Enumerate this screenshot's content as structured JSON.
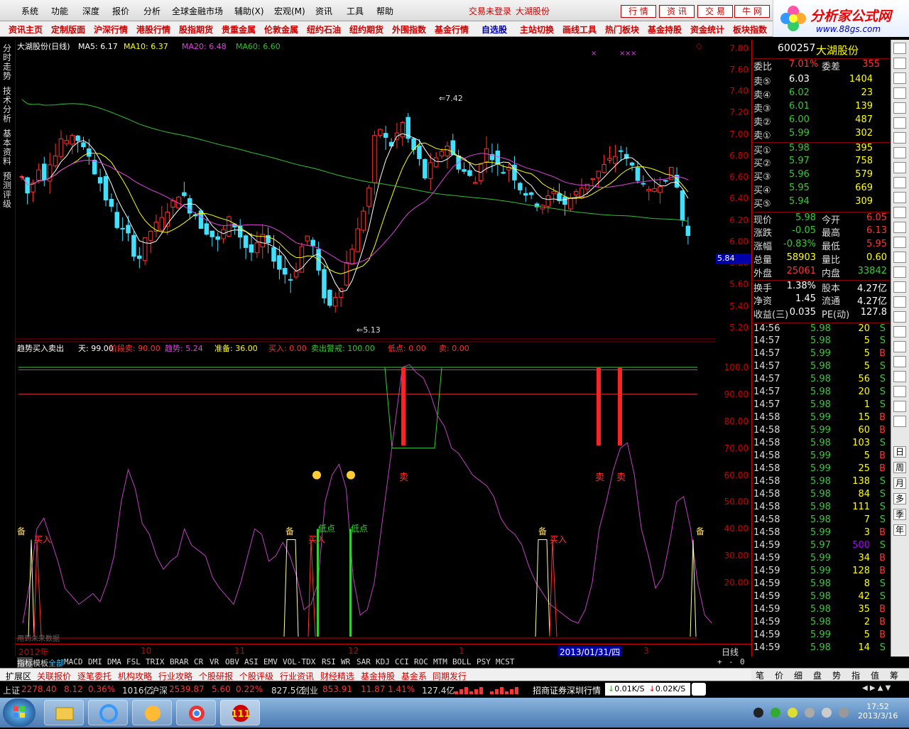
{
  "menu": {
    "items": [
      "系统",
      "功能",
      "深度",
      "报价",
      "分析",
      "全球金融市场",
      "辅助(X)",
      "宏观(M)",
      "资讯",
      "工具",
      "帮助"
    ],
    "login_status": "交易未登录",
    "stock_title": "大湖股份",
    "buttons": [
      "行 情",
      "资 讯",
      "交 易",
      "牛 网"
    ]
  },
  "logo": {
    "name": "分析家公式网",
    "url": "www.88gs.com"
  },
  "nav": {
    "items": [
      "资讯主页",
      "定制版面",
      "沪深行情",
      "港股行情",
      "股指期货",
      "贵重金属",
      "伦敦金属",
      "纽约石油",
      "纽约期货",
      "外围指数",
      "基金行情",
      "自选股",
      "主站切换",
      "画线工具",
      "热门板块",
      "基金持股",
      "资金统计",
      "板块指数"
    ]
  },
  "left_tabs": [
    "分时走势",
    "技术分析",
    "基本资料",
    "预测评级"
  ],
  "main_chart": {
    "header_name": "大湖股份(日线)",
    "ma5": "MA5: 6.17",
    "ma10": "MA10: 6.37",
    "ma20": "MA20: 6.48",
    "ma60": "MA60: 6.60",
    "high_label": "7.42",
    "low_label": "5.13",
    "price_marker": "5.84",
    "colors": {
      "up": "#ff3030",
      "down": "#40e0ff",
      "ma5": "#ffffff",
      "ma10": "#ffff00",
      "ma20": "#e040e0",
      "ma60": "#30c030"
    }
  },
  "chart_data": {
    "type": "candlestick",
    "y_ticks": [
      "7.80",
      "7.60",
      "7.40",
      "7.20",
      "7.00",
      "6.80",
      "6.60",
      "6.40",
      "6.20",
      "6.00",
      "5.80",
      "5.60",
      "5.40",
      "5.20"
    ],
    "ylim": [
      5.1,
      7.85
    ],
    "sub_y_ticks": [
      "100.0",
      "90.00",
      "80.00",
      "70.00",
      "60.00",
      "50.00",
      "40.00",
      "30.00",
      "20.00"
    ],
    "sub_ylim": [
      0,
      105
    ],
    "x_labels": [
      "2012年",
      "10",
      "11",
      "12",
      "1",
      "2013/01/31/四",
      "3"
    ],
    "period": "日线"
  },
  "sub_chart": {
    "name": "趋势买入卖出",
    "tian": "天: 99.00",
    "jieduanmai": "阶段卖: 90.00",
    "qushi": "趋势: 5.24",
    "zhunbei": "准备: 36.00",
    "mairu": "买入: 0.00",
    "maichu_jingjie": "卖出警戒: 100.00",
    "didian": "低点: 0.00",
    "mai": "卖: 0.00",
    "sell_label": "卖",
    "buy_label": "买入",
    "low_label": "低点",
    "ready_label": "备",
    "watermark": "用到未来数据"
  },
  "tabs": [
    "指标",
    "模板",
    "全部",
    "MACD",
    "DMI",
    "DMA",
    "FSL",
    "TRIX",
    "BRAR",
    "CR",
    "VR",
    "OBV",
    "ASI",
    "EMV",
    "VOL-TDX",
    "RSI",
    "WR",
    "SAR",
    "KDJ",
    "CCI",
    "ROC",
    "MTM",
    "BOLL",
    "PSY",
    "MCST"
  ],
  "tab_controls": [
    "+",
    "-",
    "0"
  ],
  "bottom_tabs": [
    "扩展区",
    "关联报价",
    "逐笔委托",
    "机构攻略",
    "行业攻略",
    "个股研报",
    "个股评级",
    "行业资讯",
    "财经精选",
    "基金持股",
    "基金系",
    "同期发行"
  ],
  "quote": {
    "code": "600257",
    "name": "大湖股份",
    "weibi_label": "委比",
    "weibi": "7.01%",
    "weicha_label": "委差",
    "weicha": "355",
    "sell": [
      {
        "label": "卖⑤",
        "price": "6.03",
        "vol": "1404"
      },
      {
        "label": "卖④",
        "price": "6.02",
        "vol": "23"
      },
      {
        "label": "卖③",
        "price": "6.01",
        "vol": "139"
      },
      {
        "label": "卖②",
        "price": "6.00",
        "vol": "487"
      },
      {
        "label": "卖①",
        "price": "5.99",
        "vol": "302"
      }
    ],
    "buy": [
      {
        "label": "买①",
        "price": "5.98",
        "vol": "395"
      },
      {
        "label": "买②",
        "price": "5.97",
        "vol": "758"
      },
      {
        "label": "买③",
        "price": "5.96",
        "vol": "579"
      },
      {
        "label": "买④",
        "price": "5.95",
        "vol": "669"
      },
      {
        "label": "买⑤",
        "price": "5.94",
        "vol": "309"
      }
    ],
    "stats": [
      {
        "l1": "现价",
        "v1": "5.98",
        "l2": "今开",
        "v2": "6.05"
      },
      {
        "l1": "涨跌",
        "v1": "-0.05",
        "l2": "最高",
        "v2": "6.13"
      },
      {
        "l1": "涨幅",
        "v1": "-0.83%",
        "l2": "最低",
        "v2": "5.95"
      },
      {
        "l1": "总量",
        "v1": "58903",
        "l2": "量比",
        "v2": "0.60"
      },
      {
        "l1": "外盘",
        "v1": "25061",
        "l2": "内盘",
        "v2": "33842"
      }
    ],
    "fund": [
      {
        "l1": "换手",
        "v1": "1.38%",
        "l2": "股本",
        "v2": "4.27亿"
      },
      {
        "l1": "净资",
        "v1": "1.45",
        "l2": "流通",
        "v2": "4.27亿"
      },
      {
        "l1": "收益(三)",
        "v1": "0.035",
        "l2": "PE(动)",
        "v2": "127.8"
      }
    ],
    "ticks": [
      {
        "t": "14:56",
        "p": "5.98",
        "v": "20",
        "s": "S"
      },
      {
        "t": "14:57",
        "p": "5.98",
        "v": "5",
        "s": "S"
      },
      {
        "t": "14:57",
        "p": "5.99",
        "v": "5",
        "s": "B"
      },
      {
        "t": "14:57",
        "p": "5.98",
        "v": "5",
        "s": "S"
      },
      {
        "t": "14:57",
        "p": "5.98",
        "v": "56",
        "s": "S"
      },
      {
        "t": "14:57",
        "p": "5.98",
        "v": "20",
        "s": "S"
      },
      {
        "t": "14:57",
        "p": "5.98",
        "v": "1",
        "s": "S"
      },
      {
        "t": "14:58",
        "p": "5.99",
        "v": "15",
        "s": "B"
      },
      {
        "t": "14:58",
        "p": "5.99",
        "v": "60",
        "s": "B"
      },
      {
        "t": "14:58",
        "p": "5.98",
        "v": "103",
        "s": "S"
      },
      {
        "t": "14:58",
        "p": "5.99",
        "v": "5",
        "s": "B"
      },
      {
        "t": "14:58",
        "p": "5.99",
        "v": "25",
        "s": "B"
      },
      {
        "t": "14:58",
        "p": "5.98",
        "v": "138",
        "s": "S"
      },
      {
        "t": "14:58",
        "p": "5.98",
        "v": "84",
        "s": "S"
      },
      {
        "t": "14:58",
        "p": "5.98",
        "v": "111",
        "s": "S"
      },
      {
        "t": "14:58",
        "p": "5.98",
        "v": "7",
        "s": "S"
      },
      {
        "t": "14:58",
        "p": "5.99",
        "v": "3",
        "s": "B"
      },
      {
        "t": "14:59",
        "p": "5.97",
        "v": "500",
        "s": "S"
      },
      {
        "t": "14:59",
        "p": "5.99",
        "v": "34",
        "s": "B"
      },
      {
        "t": "14:59",
        "p": "5.99",
        "v": "128",
        "s": "B"
      },
      {
        "t": "14:59",
        "p": "5.98",
        "v": "8",
        "s": "S"
      },
      {
        "t": "14:59",
        "p": "5.98",
        "v": "42",
        "s": "S"
      },
      {
        "t": "14:59",
        "p": "5.98",
        "v": "35",
        "s": "B"
      },
      {
        "t": "14:59",
        "p": "5.98",
        "v": "2",
        "s": "B"
      },
      {
        "t": "14:59",
        "p": "5.99",
        "v": "5",
        "s": "B"
      },
      {
        "t": "14:59",
        "p": "5.98",
        "v": "14",
        "s": "S"
      }
    ],
    "side_tabs": [
      "日",
      "周",
      "月",
      "多",
      "季",
      "年"
    ],
    "bottom_tabs": [
      "笔",
      "价",
      "细",
      "盘",
      "势",
      "指",
      "值",
      "筹"
    ]
  },
  "status": {
    "sh_label": "上证",
    "sh_val": "2278.40",
    "sh_chg": "8.12",
    "sh_pct": "0.36%",
    "sh_amt": "1016亿",
    "sz_label": "沪深",
    "sz_val": "2539.87",
    "sz_chg": "5.60",
    "sz_pct": "0.22%",
    "sz_amt": "827.5亿",
    "cy_label": "创业",
    "cy_val": "853.91",
    "cy_chg": "11.87",
    "cy_pct": "1.41%",
    "cy_amt": "127.4亿",
    "server": "招商证券深圳行情",
    "down_speed": "0.01K/S",
    "up_speed": "0.02K/S"
  },
  "taskbar": {
    "time": "17:52",
    "date": "2013/3/16"
  }
}
